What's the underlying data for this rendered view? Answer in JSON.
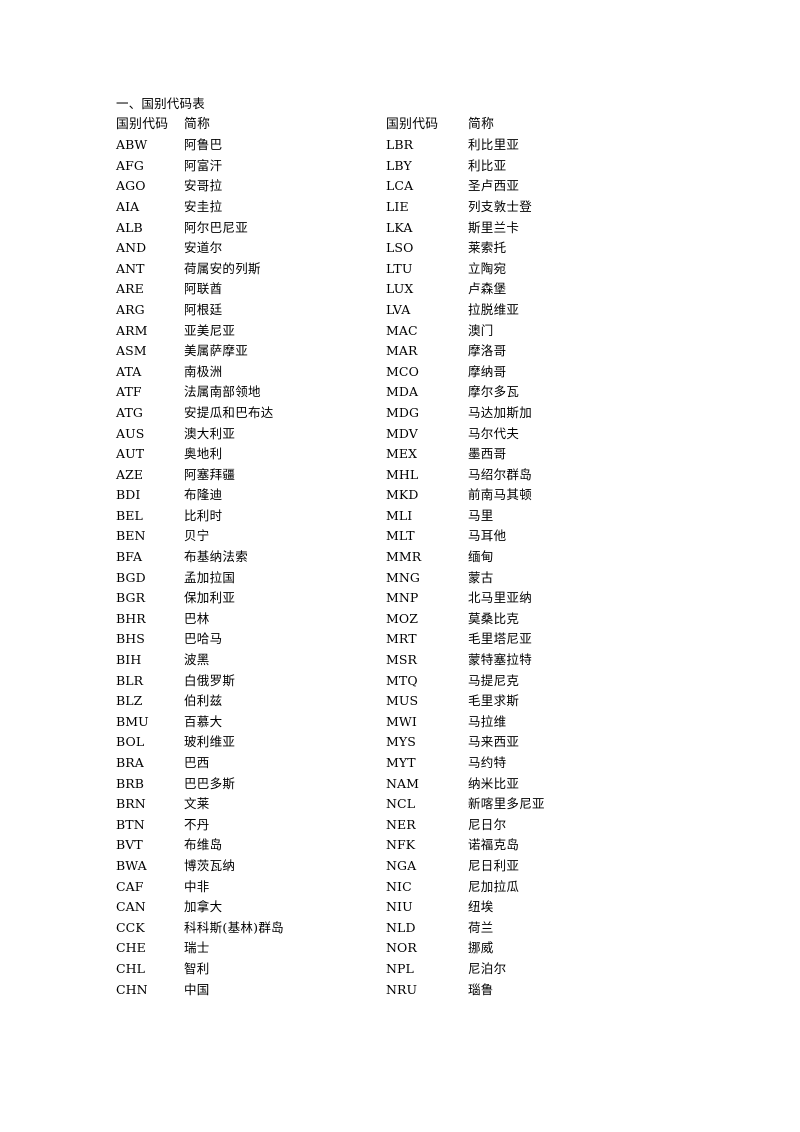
{
  "document": {
    "title": "一、国别代码表",
    "headers": {
      "code": "国别代码",
      "name": "简称"
    }
  },
  "columns": {
    "left": [
      {
        "code": "ABW",
        "name": "阿鲁巴"
      },
      {
        "code": "AFG",
        "name": "阿富汗"
      },
      {
        "code": "AGO",
        "name": "安哥拉"
      },
      {
        "code": "AIA",
        "name": "安圭拉"
      },
      {
        "code": "ALB",
        "name": "阿尔巴尼亚"
      },
      {
        "code": "AND",
        "name": "安道尔"
      },
      {
        "code": "ANT",
        "name": "荷属安的列斯"
      },
      {
        "code": "ARE",
        "name": "阿联酋"
      },
      {
        "code": "ARG",
        "name": "阿根廷"
      },
      {
        "code": "ARM",
        "name": "亚美尼亚"
      },
      {
        "code": "ASM",
        "name": "美属萨摩亚"
      },
      {
        "code": "ATA",
        "name": "南极洲"
      },
      {
        "code": "ATF",
        "name": "法属南部领地"
      },
      {
        "code": "ATG",
        "name": "安提瓜和巴布达"
      },
      {
        "code": "AUS",
        "name": "澳大利亚"
      },
      {
        "code": "AUT",
        "name": "奥地利"
      },
      {
        "code": "AZE",
        "name": "阿塞拜疆"
      },
      {
        "code": "BDI",
        "name": "布隆迪"
      },
      {
        "code": "BEL",
        "name": "比利时"
      },
      {
        "code": "BEN",
        "name": "贝宁"
      },
      {
        "code": "BFA",
        "name": "布基纳法索"
      },
      {
        "code": "BGD",
        "name": "孟加拉国"
      },
      {
        "code": "BGR",
        "name": "保加利亚"
      },
      {
        "code": "BHR",
        "name": "巴林"
      },
      {
        "code": "BHS",
        "name": "巴哈马"
      },
      {
        "code": "BIH",
        "name": "波黑"
      },
      {
        "code": "BLR",
        "name": "白俄罗斯"
      },
      {
        "code": "BLZ",
        "name": "伯利兹"
      },
      {
        "code": "BMU",
        "name": "百慕大"
      },
      {
        "code": "BOL",
        "name": "玻利维亚"
      },
      {
        "code": "BRA",
        "name": "巴西"
      },
      {
        "code": "BRB",
        "name": "巴巴多斯"
      },
      {
        "code": "BRN",
        "name": "文莱"
      },
      {
        "code": "BTN",
        "name": "不丹"
      },
      {
        "code": "BVT",
        "name": "布维岛"
      },
      {
        "code": "BWA",
        "name": "博茨瓦纳"
      },
      {
        "code": "CAF",
        "name": "中非"
      },
      {
        "code": "CAN",
        "name": "加拿大"
      },
      {
        "code": "CCK",
        "name": "科科斯(基林)群岛"
      },
      {
        "code": "CHE",
        "name": "瑞士"
      },
      {
        "code": "CHL",
        "name": "智利"
      },
      {
        "code": "CHN",
        "name": "中国"
      }
    ],
    "right": [
      {
        "code": "LBR",
        "name": "利比里亚"
      },
      {
        "code": "LBY",
        "name": "利比亚"
      },
      {
        "code": "LCA",
        "name": "圣卢西亚"
      },
      {
        "code": "LIE",
        "name": "列支敦士登"
      },
      {
        "code": "LKA",
        "name": "斯里兰卡"
      },
      {
        "code": "LSO",
        "name": "莱索托"
      },
      {
        "code": "LTU",
        "name": "立陶宛"
      },
      {
        "code": "LUX",
        "name": "卢森堡"
      },
      {
        "code": "LVA",
        "name": "拉脱维亚"
      },
      {
        "code": "MAC",
        "name": "澳门"
      },
      {
        "code": "MAR",
        "name": "摩洛哥"
      },
      {
        "code": "MCO",
        "name": "摩纳哥"
      },
      {
        "code": "MDA",
        "name": "摩尔多瓦"
      },
      {
        "code": "MDG",
        "name": "马达加斯加"
      },
      {
        "code": "MDV",
        "name": "马尔代夫"
      },
      {
        "code": "MEX",
        "name": "墨西哥"
      },
      {
        "code": "MHL",
        "name": "马绍尔群岛"
      },
      {
        "code": "MKD",
        "name": "前南马其顿"
      },
      {
        "code": "MLI",
        "name": "马里"
      },
      {
        "code": "MLT",
        "name": "马耳他"
      },
      {
        "code": "MMR",
        "name": "缅甸"
      },
      {
        "code": "MNG",
        "name": "蒙古"
      },
      {
        "code": "MNP",
        "name": "北马里亚纳"
      },
      {
        "code": "MOZ",
        "name": "莫桑比克"
      },
      {
        "code": "MRT",
        "name": "毛里塔尼亚"
      },
      {
        "code": "MSR",
        "name": "蒙特塞拉特"
      },
      {
        "code": "MTQ",
        "name": "马提尼克"
      },
      {
        "code": "MUS",
        "name": "毛里求斯"
      },
      {
        "code": "MWI",
        "name": "马拉维"
      },
      {
        "code": "MYS",
        "name": "马来西亚"
      },
      {
        "code": "MYT",
        "name": "马约特"
      },
      {
        "code": "NAM",
        "name": "纳米比亚"
      },
      {
        "code": "NCL",
        "name": "新喀里多尼亚"
      },
      {
        "code": "NER",
        "name": "尼日尔"
      },
      {
        "code": "NFK",
        "name": "诺福克岛"
      },
      {
        "code": "NGA",
        "name": "尼日利亚"
      },
      {
        "code": "NIC",
        "name": "尼加拉瓜"
      },
      {
        "code": "NIU",
        "name": "纽埃"
      },
      {
        "code": "NLD",
        "name": "荷兰"
      },
      {
        "code": "NOR",
        "name": "挪威"
      },
      {
        "code": "NPL",
        "name": "尼泊尔"
      },
      {
        "code": "NRU",
        "name": "瑙鲁"
      }
    ]
  }
}
